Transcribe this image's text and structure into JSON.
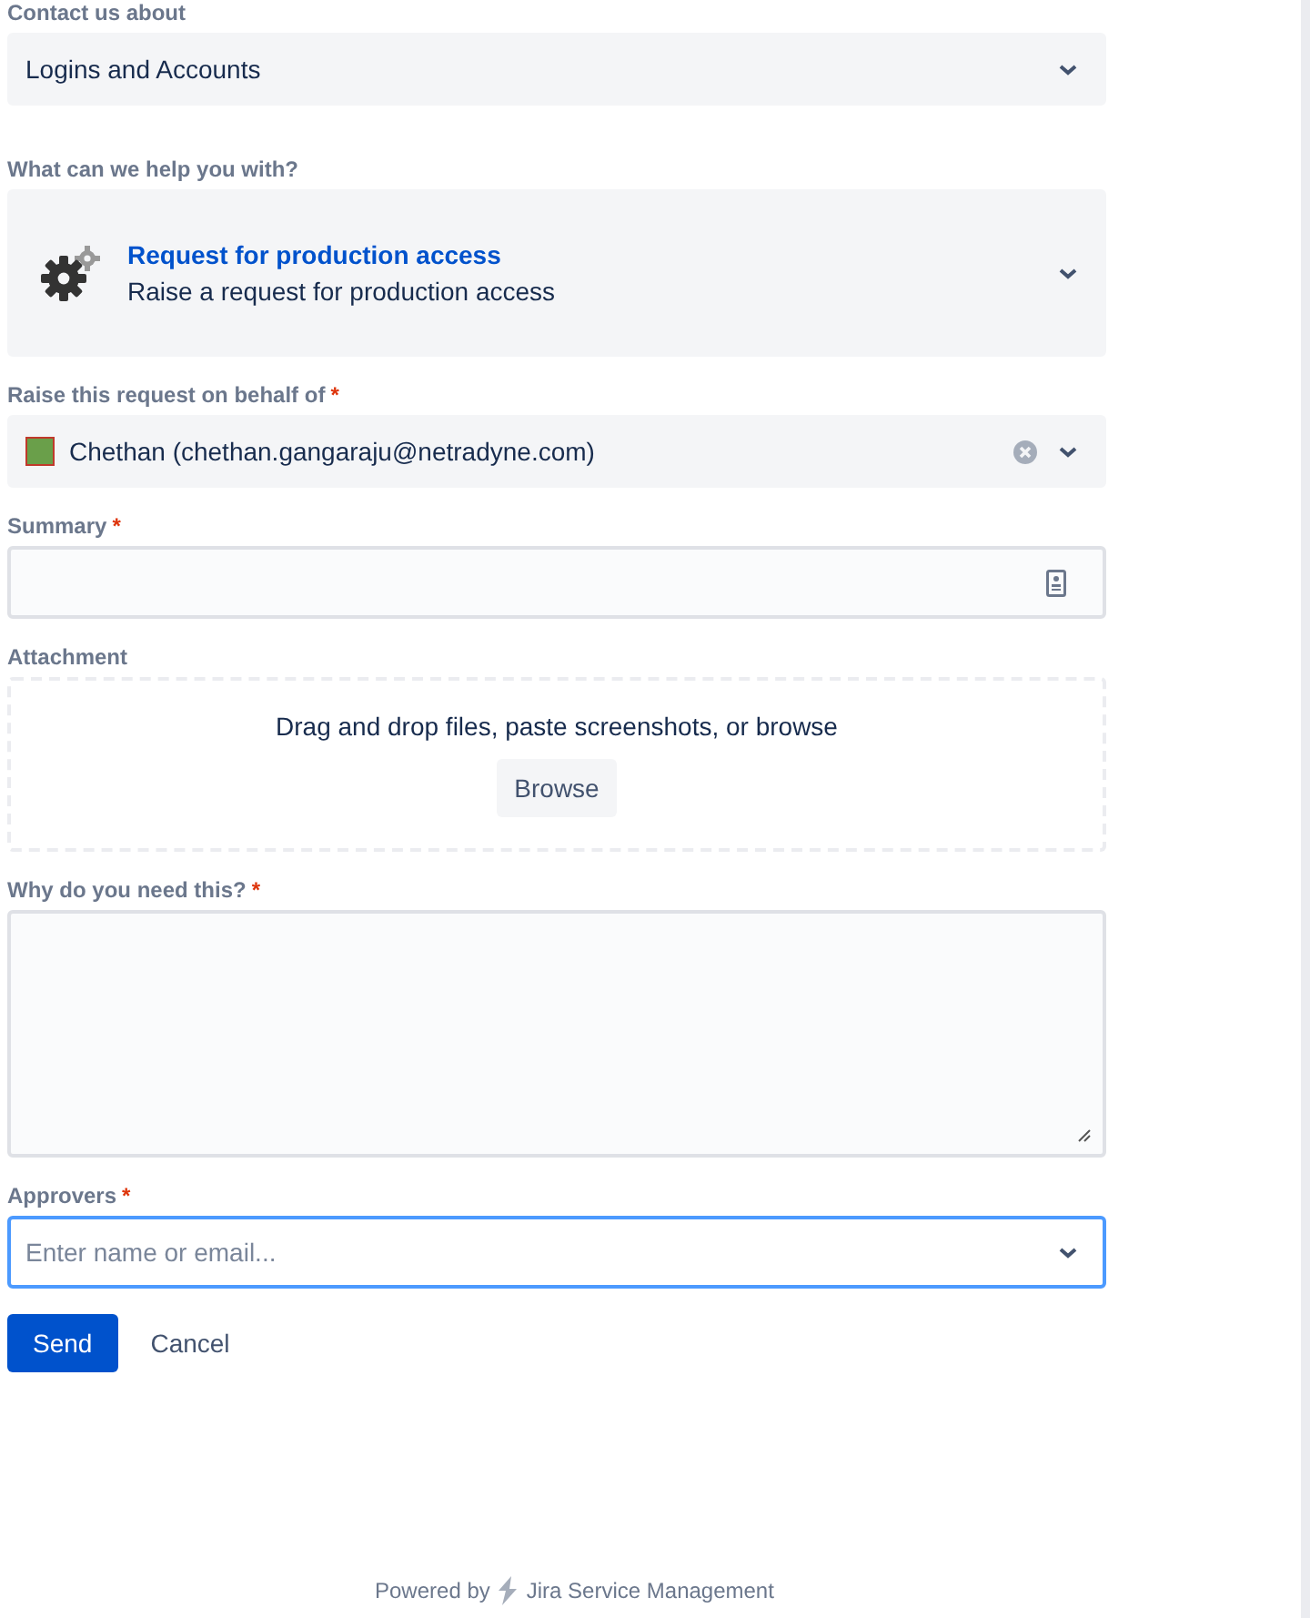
{
  "fields": [
    {
      "kind": "select",
      "label": "Contact us about",
      "value": "Logins and Accounts"
    },
    {
      "kind": "request-type",
      "label": "What can we help you with?",
      "title": "Request for production access",
      "description": "Raise a request for production access"
    },
    {
      "kind": "user-select",
      "label": "Raise this request on behalf of",
      "required_mark": "*",
      "value": "Chethan (chethan.gangaraju@netradyne.com)"
    },
    {
      "kind": "text",
      "label": "Summary",
      "required_mark": "*"
    },
    {
      "kind": "attachment",
      "label": "Attachment",
      "hint": "Drag and drop files, paste screenshots, or browse",
      "button": "Browse"
    },
    {
      "kind": "textarea",
      "label": "Why do you need this?",
      "required_mark": "*"
    },
    {
      "kind": "select",
      "label": "Approvers",
      "required_mark": "*",
      "placeholder": "Enter name or email...",
      "focused": true
    }
  ],
  "buttons": {
    "send": "Send",
    "cancel": "Cancel"
  },
  "footer": {
    "prefix": "Powered by",
    "product": "Jira Service Management"
  }
}
